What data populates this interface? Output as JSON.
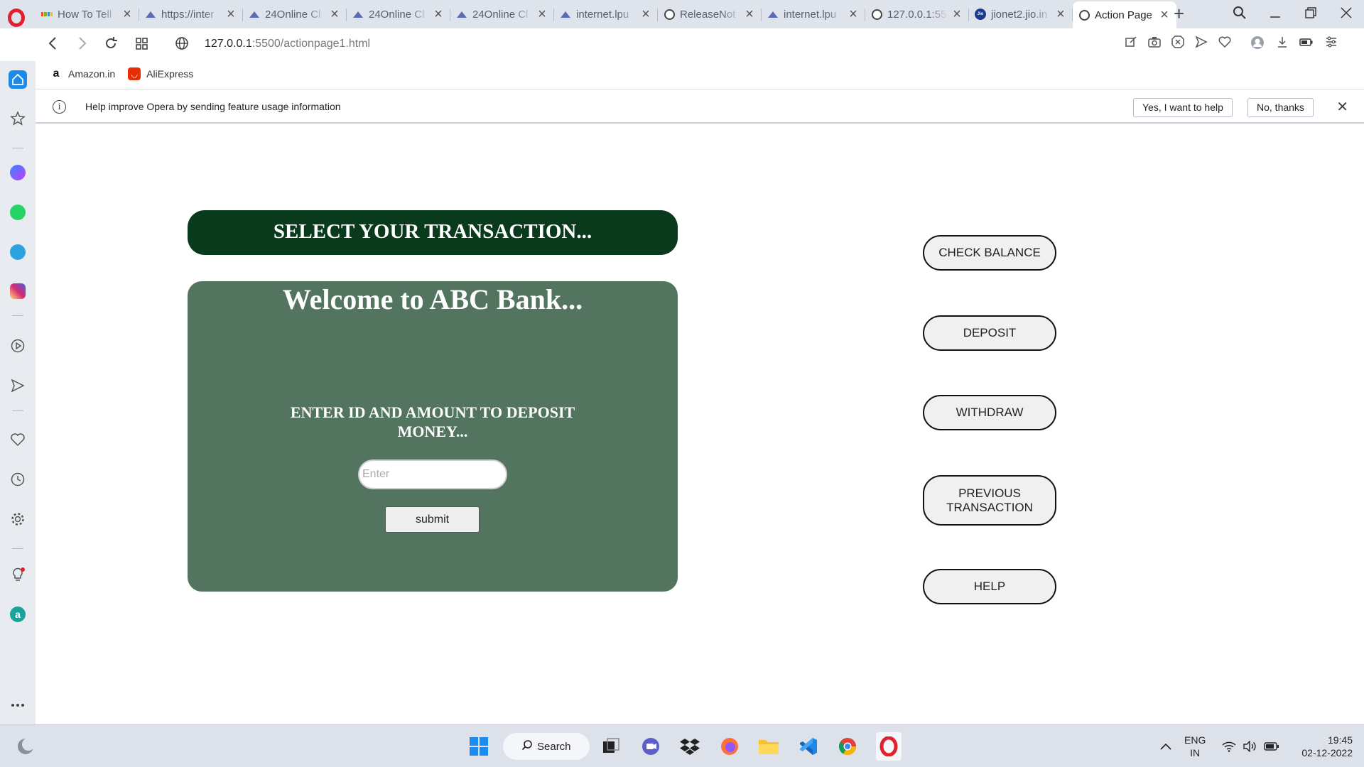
{
  "browser": {
    "tabs": [
      {
        "title": "How To Tell",
        "favicon": "microsoft-icon"
      },
      {
        "title": "https://inter",
        "favicon": "triangle-icon"
      },
      {
        "title": "24Online Cl",
        "favicon": "triangle-icon"
      },
      {
        "title": "24Online Cl",
        "favicon": "triangle-icon"
      },
      {
        "title": "24Online Cl",
        "favicon": "triangle-icon"
      },
      {
        "title": "internet.lpu",
        "favicon": "triangle-icon"
      },
      {
        "title": "ReleaseNot",
        "favicon": "globe-icon"
      },
      {
        "title": "internet.lpu",
        "favicon": "triangle-icon"
      },
      {
        "title": "127.0.0.1:55",
        "favicon": "globe-icon"
      },
      {
        "title": "jionet2.jio.in",
        "favicon": "jio-icon"
      },
      {
        "title": "Action Page",
        "favicon": "globe-icon"
      }
    ],
    "url_host": "127.0.0.1",
    "url_path": ":5500/actionpage1.html",
    "bookmarks": [
      {
        "label": "Amazon.in",
        "icon": "amazon-icon"
      },
      {
        "label": "AliExpress",
        "icon": "aliexpress-icon"
      }
    ],
    "infobar": {
      "text": "Help improve Opera by sending feature usage information",
      "yes_label": "Yes, I want to help",
      "no_label": "No, thanks"
    }
  },
  "page": {
    "banner": "SELECT YOUR TRANSACTION...",
    "welcome": "Welcome to ABC Bank...",
    "prompt": "ENTER ID AND AMOUNT TO DEPOSIT MONEY...",
    "input_placeholder": "Enter",
    "submit_label": "submit",
    "actions": {
      "check_balance": "CHECK BALANCE",
      "deposit": "DEPOSIT",
      "withdraw": "WITHDRAW",
      "previous_transaction": "PREVIOUS TRANSACTION",
      "help": "HELP"
    },
    "colors": {
      "banner": "#093a1c",
      "panel": "#537560"
    }
  },
  "taskbar": {
    "search_label": "Search",
    "lang_top": "ENG",
    "lang_bottom": "IN",
    "time": "19:45",
    "date": "02-12-2022"
  }
}
